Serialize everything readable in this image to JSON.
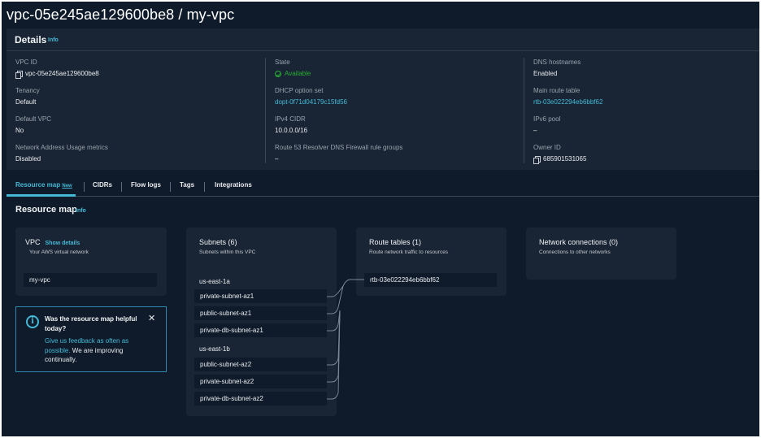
{
  "page": {
    "title": "vpc-05e245ae129600be8 / my-vpc"
  },
  "details": {
    "heading": "Details",
    "info": "Info",
    "fields": {
      "vpc_id": {
        "label": "VPC ID",
        "value": "vpc-05e245ae129600be8"
      },
      "tenancy": {
        "label": "Tenancy",
        "value": "Default"
      },
      "default_vpc": {
        "label": "Default VPC",
        "value": "No"
      },
      "nau_metrics": {
        "label": "Network Address Usage metrics",
        "value": "Disabled"
      },
      "state": {
        "label": "State",
        "value": "Available"
      },
      "dhcp": {
        "label": "DHCP option set",
        "value": "dopt-0f71d04179c15fd56"
      },
      "ipv4_cidr": {
        "label": "IPv4 CIDR",
        "value": "10.0.0.0/16"
      },
      "route53": {
        "label": "Route 53 Resolver DNS Firewall rule groups",
        "value": "–"
      },
      "dns_hostnames": {
        "label": "DNS hostnames",
        "value": "Enabled"
      },
      "main_route_table": {
        "label": "Main route table",
        "value": "rtb-03e022294eb6bbf62"
      },
      "ipv6_pool": {
        "label": "IPv6 pool",
        "value": "–"
      },
      "owner_id": {
        "label": "Owner ID",
        "value": "685901531065"
      }
    }
  },
  "tabs": [
    {
      "label": "Resource map",
      "badge": "New",
      "active": true
    },
    {
      "label": "CIDRs"
    },
    {
      "label": "Flow logs"
    },
    {
      "label": "Tags"
    },
    {
      "label": "Integrations"
    }
  ],
  "resource_map": {
    "title": "Resource map",
    "info": "Info",
    "vpc_card": {
      "title": "VPC",
      "show_details": "Show details",
      "subtitle": "Your AWS virtual network",
      "item": "my-vpc"
    },
    "subnets_card": {
      "title": "Subnets (6)",
      "subtitle": "Subnets within this VPC",
      "groups": [
        {
          "az": "us-east-1a",
          "items": [
            "private-subnet-az1",
            "public-subnet-az1",
            "private-db-subnet-az1"
          ]
        },
        {
          "az": "us-east-1b",
          "items": [
            "public-subnet-az2",
            "private-subnet-az2",
            "private-db-subnet-az2"
          ]
        }
      ]
    },
    "route_tables_card": {
      "title": "Route tables (1)",
      "subtitle": "Route network traffic to resources",
      "item": "rtb-03e022294eb6bbf62"
    },
    "network_connections_card": {
      "title": "Network connections (0)",
      "subtitle": "Connections to other networks"
    }
  },
  "feedback": {
    "title": "Was the resource map helpful today?",
    "link_text": "Give us feedback as often as possible.",
    "text": " We are improving continually."
  },
  "colors": {
    "background": "#0f1b2a",
    "panel": "#192534",
    "accent": "#44b9d6",
    "success": "#29ad32"
  }
}
